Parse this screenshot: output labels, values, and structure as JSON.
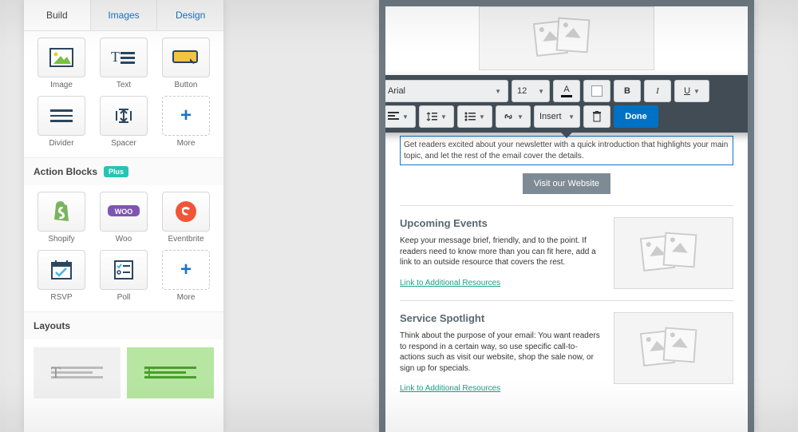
{
  "sidebar": {
    "tabs": {
      "build": "Build",
      "images": "Images",
      "design": "Design"
    },
    "blocks": {
      "image": "Image",
      "text": "Text",
      "button": "Button",
      "divider": "Divider",
      "spacer": "Spacer",
      "more1": "More"
    },
    "action_title": "Action Blocks",
    "plus_badge": "Plus",
    "action_blocks": {
      "shopify": "Shopify",
      "woo": "Woo",
      "eventbrite": "Eventbrite",
      "rsvp": "RSVP",
      "poll": "Poll",
      "more2": "More"
    },
    "layouts_title": "Layouts"
  },
  "toolbar": {
    "font": "Arial",
    "size": "12",
    "bold": "B",
    "italic": "I",
    "underline": "U",
    "insert": "Insert",
    "done": "Done"
  },
  "canvas": {
    "intro": "Get readers excited about your newsletter with a quick introduction that highlights your main topic, and let the rest of the email cover the details.",
    "cta": "Visit our Website",
    "sec1": {
      "title": "Upcoming Events",
      "body": "Keep your message brief, friendly, and to the point. If readers need to know more than you can fit here, add a link to an outside resource that covers the rest.",
      "link": "Link to Additional Resources"
    },
    "sec2": {
      "title": "Service Spotlight",
      "body": "Think about the purpose of your email: You want readers to respond in a certain way, so use specific call-to-actions such as visit our website, shop the sale now, or sign up for specials.",
      "link": "Link to Additional Resources"
    }
  }
}
